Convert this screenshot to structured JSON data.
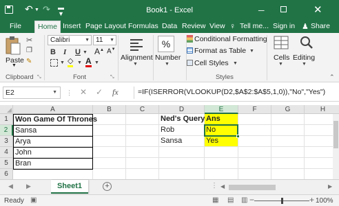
{
  "app": {
    "title": "Book1 - Excel"
  },
  "window": {
    "minimize": "─",
    "close": "✕"
  },
  "tabs": {
    "file": "File",
    "home": "Home",
    "insert": "Insert",
    "page_layout": "Page Layout",
    "formulas": "Formulas",
    "data": "Data",
    "review": "Review",
    "view": "View",
    "tell_me": "Tell me...",
    "sign_in": "Sign in",
    "share": "Share"
  },
  "ribbon": {
    "paste": "Paste",
    "clipboard": "Clipboard",
    "font_name": "Calibri",
    "font_size": "11",
    "bold": "B",
    "italic": "I",
    "underline": "U",
    "font_group": "Font",
    "alignment": "Alignment",
    "number_symbol": "%",
    "number": "Number",
    "conditional_formatting": "Conditional Formatting",
    "format_as_table": "Format as Table",
    "cell_styles": "Cell Styles",
    "styles": "Styles",
    "cells": "Cells",
    "editing": "Editing"
  },
  "formula_bar": {
    "name_box": "E2",
    "fx": "fx",
    "cancel": "✕",
    "enter": "✓",
    "formula": "=IF(ISERROR(VLOOKUP(D2,$A$2:$A$5,1,0)),\"No\",\"Yes\")"
  },
  "grid": {
    "columns": [
      "A",
      "B",
      "C",
      "D",
      "E",
      "F",
      "G",
      "H"
    ],
    "rows": [
      "1",
      "2",
      "3",
      "4",
      "5",
      "6"
    ],
    "cells": {
      "A1": "Won Game Of Thrones",
      "A2": "Sansa",
      "A3": "Arya",
      "A4": "John",
      "A5": "Bran",
      "D1": "Ned's Query",
      "D2": "Rob",
      "D3": "Sansa",
      "E1": "Ans",
      "E2": "No",
      "E3": "Yes"
    },
    "highlight_color": "#ffff00",
    "accent_color": "#217346"
  },
  "sheets": {
    "active": "Sheet1"
  },
  "status": {
    "ready": "Ready",
    "zoom": "100%",
    "zoom_minus": "−",
    "zoom_plus": "+"
  }
}
